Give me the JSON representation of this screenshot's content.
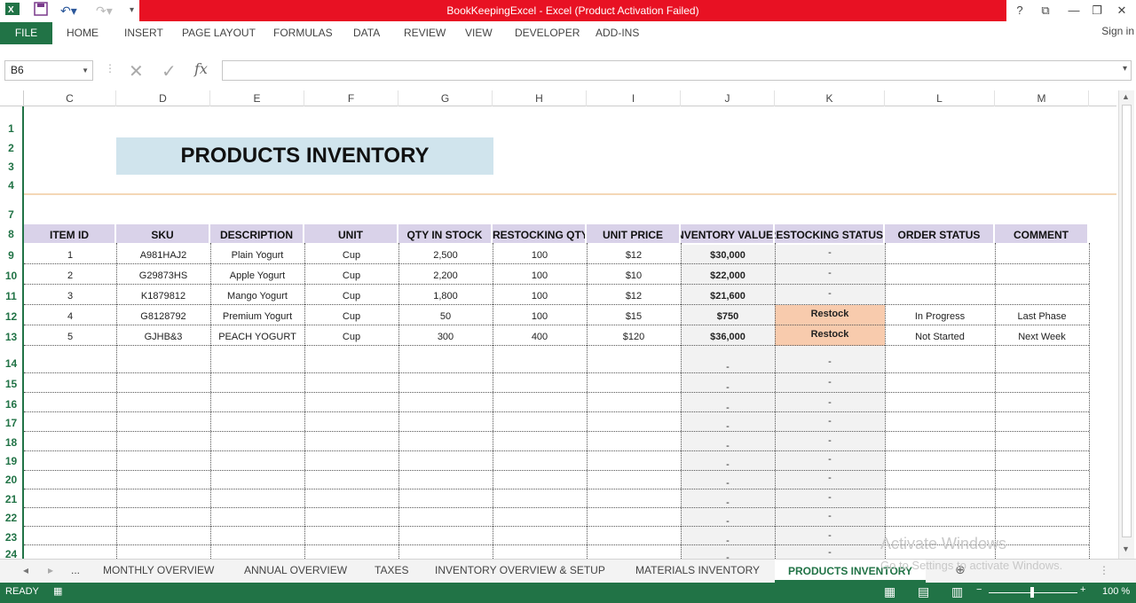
{
  "titlebar": {
    "title": "BookKeepingExcel -  Excel (Product Activation Failed)",
    "help": "?",
    "minimize": "—",
    "restore": "❐",
    "close": "✕"
  },
  "ribbon": {
    "file": "FILE",
    "tabs": [
      "HOME",
      "INSERT",
      "PAGE LAYOUT",
      "FORMULAS",
      "DATA",
      "REVIEW",
      "VIEW",
      "DEVELOPER",
      "ADD-INS"
    ],
    "signin": "Sign in"
  },
  "formula_bar": {
    "name_box": "B6",
    "fx": "fx",
    "value": ""
  },
  "columns": [
    "C",
    "D",
    "E",
    "F",
    "G",
    "H",
    "I",
    "J",
    "K",
    "L",
    "M"
  ],
  "rows": [
    "1",
    "2",
    "3",
    "4",
    "7",
    "8",
    "9",
    "10",
    "11",
    "12",
    "13",
    "14",
    "15",
    "16",
    "17",
    "18",
    "19",
    "20",
    "21",
    "22",
    "23",
    "24"
  ],
  "sheet": {
    "title": "PRODUCTS INVENTORY",
    "table_headers": [
      "ITEM ID",
      "SKU",
      "DESCRIPTION",
      "UNIT",
      "QTY IN STOCK",
      "RESTOCKING QTY",
      "UNIT PRICE",
      "INVENTORY VALUE",
      "RESTOCKING STATUS",
      "ORDER STATUS",
      "COMMENT"
    ],
    "table_rows": [
      [
        "1",
        "A981HAJ2",
        "Plain Yogurt",
        "Cup",
        "2,500",
        "100",
        "$12",
        "$30,000",
        "-",
        "",
        ""
      ],
      [
        "2",
        "G29873HS",
        "Apple Yogurt",
        "Cup",
        "2,200",
        "100",
        "$10",
        "$22,000",
        "-",
        "",
        ""
      ],
      [
        "3",
        "K1879812",
        "Mango Yogurt",
        "Cup",
        "1,800",
        "100",
        "$12",
        "$21,600",
        "-",
        "",
        ""
      ],
      [
        "4",
        "G8128792",
        "Premium Yogurt",
        "Cup",
        "50",
        "100",
        "$15",
        "$750",
        "Restock",
        "In Progress",
        "Last Phase"
      ],
      [
        "5",
        "GJHB&3",
        "PEACH YOGURT",
        "Cup",
        "300",
        "400",
        "$120",
        "$36,000",
        "Restock",
        "Not Started",
        "Next Week"
      ]
    ],
    "empty_dash": "-"
  },
  "sheet_tabs": {
    "ellipsis": "...",
    "tabs": [
      "MONTHLY OVERVIEW",
      "ANNUAL OVERVIEW",
      "TAXES",
      "INVENTORY OVERVIEW & SETUP",
      "MATERIALS INVENTORY"
    ],
    "active": "PRODUCTS INVENTORY"
  },
  "statusbar": {
    "ready": "READY",
    "zoom": "100 %"
  },
  "watermark": {
    "line1": "Activate Windows",
    "line2": "Go to Settings to activate Windows."
  },
  "colors": {
    "excel_green": "#217346",
    "title_red": "#e81123",
    "header_fill": "#d9d2e9",
    "title_fill": "#d0e4ed",
    "restock_fill": "#f8cbad"
  }
}
